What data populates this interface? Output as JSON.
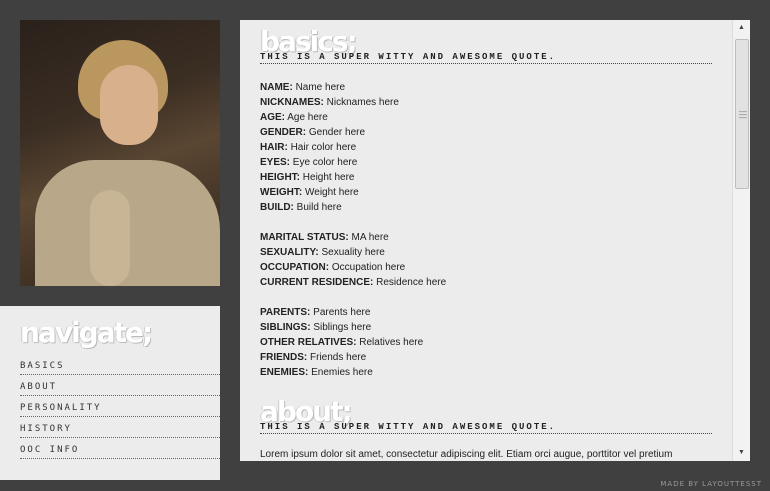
{
  "navigate": {
    "title": "navigate;",
    "items": [
      "BASICS",
      "ABOUT",
      "PERSONALITY",
      "HISTORY",
      "OOC INFO"
    ]
  },
  "basics": {
    "title": "basics;",
    "quote": "THIS IS A SUPER WITTY AND AWESOME QUOTE.",
    "fields": [
      {
        "label": "NAME:",
        "value": "Name here"
      },
      {
        "label": "NICKNAMES:",
        "value": "Nicknames here"
      },
      {
        "label": "AGE:",
        "value": "Age here"
      },
      {
        "label": "GENDER:",
        "value": "Gender here"
      },
      {
        "label": "HAIR:",
        "value": "Hair color here"
      },
      {
        "label": "EYES:",
        "value": "Eye color here"
      },
      {
        "label": "HEIGHT:",
        "value": "Height here"
      },
      {
        "label": "WEIGHT:",
        "value": "Weight here"
      },
      {
        "label": "BUILD:",
        "value": "Build here"
      },
      {
        "label": "MARITAL STATUS:",
        "value": "MA here"
      },
      {
        "label": "SEXUALITY:",
        "value": "Sexuality here"
      },
      {
        "label": "OCCUPATION:",
        "value": "Occupation here"
      },
      {
        "label": "CURRENT RESIDENCE:",
        "value": "Residence here"
      },
      {
        "label": "PARENTS:",
        "value": "Parents here"
      },
      {
        "label": "SIBLINGS:",
        "value": "Siblings here"
      },
      {
        "label": "OTHER RELATIVES:",
        "value": "Relatives here"
      },
      {
        "label": "FRIENDS:",
        "value": "Friends here"
      },
      {
        "label": "ENEMIES:",
        "value": "Enemies here"
      }
    ]
  },
  "about": {
    "title": "about;",
    "quote": "THIS IS A SUPER WITTY AND AWESOME QUOTE.",
    "text": "Lorem ipsum dolor sit amet, consectetur adipiscing elit. Etiam orci augue, porttitor vel pretium"
  },
  "credit": "MADE BY LAYOUTTESST",
  "icons": {
    "scroll_up": "triangle-up-icon",
    "scroll_down": "triangle-down-icon"
  },
  "colors": {
    "background": "#404040",
    "panel": "#ececec"
  }
}
